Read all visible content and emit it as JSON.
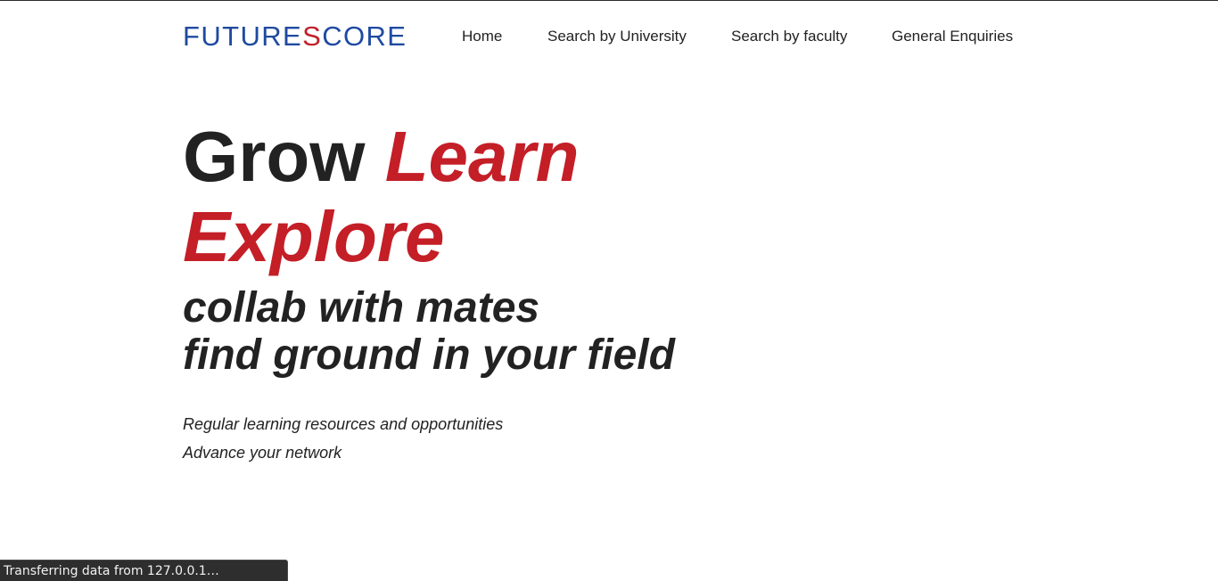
{
  "brand": {
    "prefix": "FUTURE",
    "accent": "S",
    "suffix": "CORE",
    "colors": {
      "primary": "#1f4aa0",
      "accent": "#c0202a"
    }
  },
  "nav": {
    "items": [
      {
        "label": "Home"
      },
      {
        "label": "Search by University"
      },
      {
        "label": "Search by faculty"
      },
      {
        "label": "General Enquiries"
      }
    ]
  },
  "hero": {
    "word_grow": "Grow",
    "word_learn": "Learn",
    "word_explore": "Explore",
    "sub_line_1": "collab with mates",
    "sub_line_2": "find ground in your field",
    "point_1": "Regular learning resources and opportunities",
    "point_2": "Advance your network",
    "colors": {
      "text": "#222222",
      "highlight": "#c41e27"
    }
  },
  "status": {
    "text": "Transferring data from 127.0.0.1…"
  }
}
